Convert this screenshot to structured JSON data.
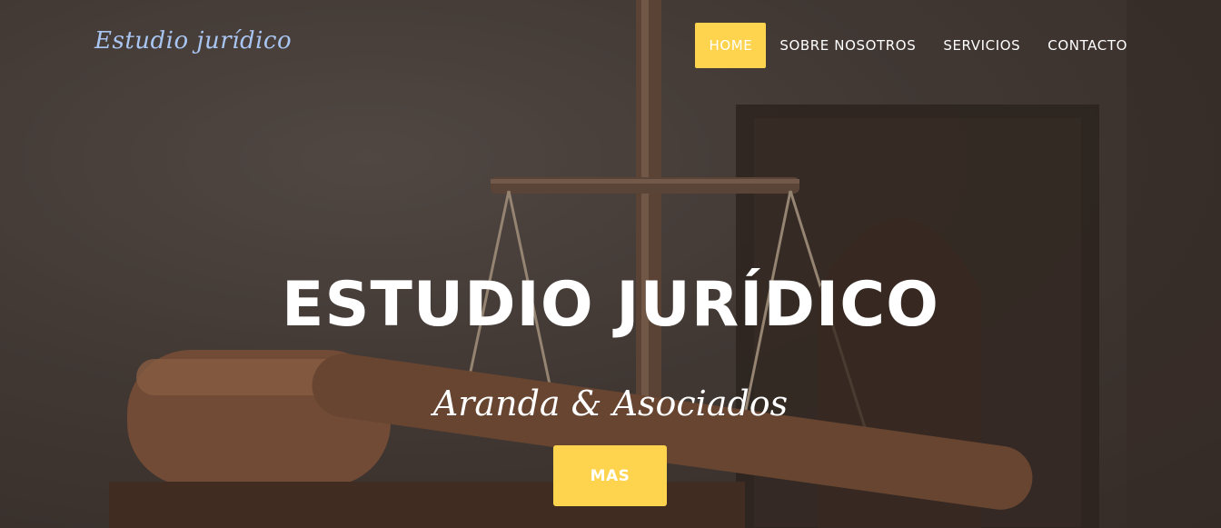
{
  "brand": "Estudio jurídico",
  "nav": {
    "items": [
      {
        "label": "HOME",
        "active": true
      },
      {
        "label": "SOBRE NOSOTROS"
      },
      {
        "label": "SERVICIOS"
      },
      {
        "label": "CONTACTO"
      }
    ]
  },
  "hero": {
    "title": "ESTUDIO JURÍDICO",
    "subtitle": "Aranda & Asociados",
    "cta_label": "MAS"
  },
  "colors": {
    "accent": "#fed44f",
    "brand_text": "#a9c6f2",
    "text": "#ffffff"
  }
}
